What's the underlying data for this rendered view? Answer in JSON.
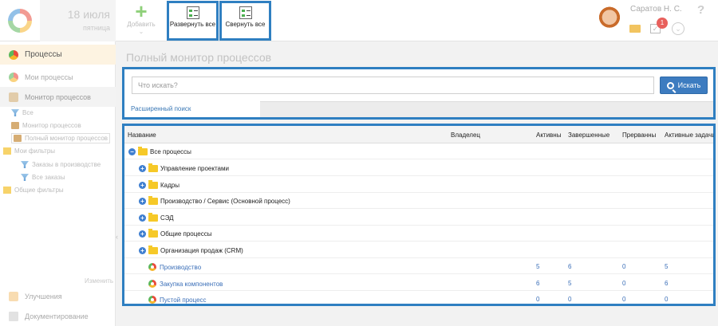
{
  "header": {
    "date_day": "18 июля",
    "date_weekday": "пятница",
    "add_label": "Добавить",
    "expand_all_label": "Развернуть все",
    "collapse_all_label": "Свернуть все",
    "user_name": "Саратов Н. С.",
    "task_badge": "1",
    "help_label": "?"
  },
  "sidebar": {
    "processes": "Процессы",
    "my_processes": "Мои процессы",
    "process_monitor": "Монитор процессов",
    "tree": {
      "all": "Все",
      "monitor": "Монитор процессов",
      "full_monitor": "Полный монитор процессов",
      "my_filters": "Мои фильтры",
      "orders_production": "Заказы в производстве",
      "all_orders": "Все заказы",
      "common_filters": "Общие фильтры"
    },
    "edit": "Изменить",
    "improvements": "Улучшения",
    "documentation": "Документирование"
  },
  "main": {
    "title": "Полный монитор процессов",
    "search": {
      "placeholder": "Что искать?",
      "button": "Искать",
      "advanced": "Расширенный поиск"
    },
    "grid": {
      "columns": {
        "name": "Название",
        "owner": "Владелец",
        "active": "Активны",
        "completed": "Завершенные",
        "interrupted": "Прерванны",
        "active_tasks": "Активные задачи"
      },
      "rows": [
        {
          "name": "Все процессы",
          "kind": "root"
        },
        {
          "name": "Управление проектами",
          "kind": "folder"
        },
        {
          "name": "Кадры",
          "kind": "folder"
        },
        {
          "name": "Производство / Сервис (Основной процесс)",
          "kind": "folder"
        },
        {
          "name": "СЭД",
          "kind": "folder"
        },
        {
          "name": "Общие процессы",
          "kind": "folder"
        },
        {
          "name": "Организация продаж (CRM)",
          "kind": "folder"
        },
        {
          "name": "Производство",
          "kind": "process",
          "active": "5",
          "completed": "6",
          "interrupted": "0",
          "active_tasks": "5"
        },
        {
          "name": "Закупка компонентов",
          "kind": "process",
          "active": "6",
          "completed": "5",
          "interrupted": "0",
          "active_tasks": "6"
        },
        {
          "name": "Пустой процесс",
          "kind": "process",
          "active": "0",
          "completed": "0",
          "interrupted": "0",
          "active_tasks": "0"
        }
      ]
    }
  }
}
